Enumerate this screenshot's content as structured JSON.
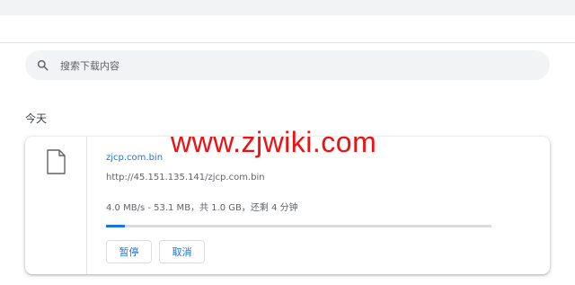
{
  "search": {
    "placeholder": "搜索下载内容"
  },
  "section": {
    "date_heading": "今天"
  },
  "download": {
    "file_name": "zjcp.com.bin",
    "url": "http://45.151.135.141/zjcp.com.bin",
    "progress_text": "4.0 MB/s - 53.1 MB，共 1.0 GB，还剩 4 分钟",
    "progress_fraction": 0.05,
    "pause_label": "暂停",
    "cancel_label": "取消"
  },
  "watermark": {
    "text": "www.zjwiki.com"
  },
  "colors": {
    "accent": "#1a73e8",
    "watermark": "#ee1111",
    "background_bar": "#f1f3f4"
  },
  "icons": {
    "search": "search-icon",
    "file": "file-icon"
  }
}
